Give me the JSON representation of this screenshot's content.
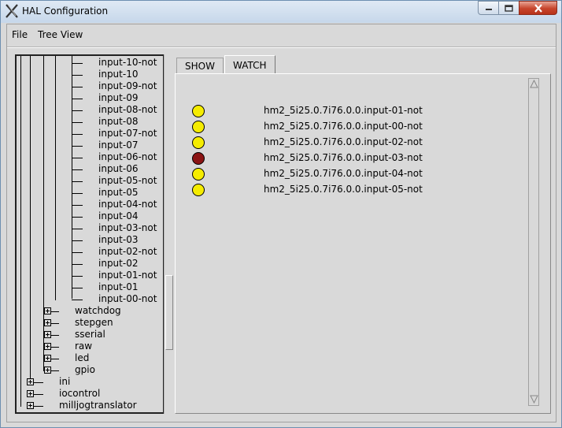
{
  "window": {
    "title": "HAL Configuration"
  },
  "menu": [
    "File",
    "Tree View"
  ],
  "tree": {
    "pins": [
      "input-10-not",
      "input-10",
      "input-09-not",
      "input-09",
      "input-08-not",
      "input-08",
      "input-07-not",
      "input-07",
      "input-06-not",
      "input-06",
      "input-05-not",
      "input-05",
      "input-04-not",
      "input-04",
      "input-03-not",
      "input-03",
      "input-02-not",
      "input-02",
      "input-01-not",
      "input-01",
      "input-00-not"
    ],
    "groups": [
      "watchdog",
      "stepgen",
      "sserial",
      "raw",
      "led",
      "gpio"
    ],
    "top_level": [
      "ini",
      "iocontrol",
      "milljogtranslator"
    ]
  },
  "tabs": [
    {
      "label": "SHOW",
      "active": false
    },
    {
      "label": "WATCH",
      "active": true
    }
  ],
  "watch": [
    {
      "name": "hm2_5i25.0.7i76.0.0.input-01-not",
      "state": "on",
      "color": "#f5ec00"
    },
    {
      "name": "hm2_5i25.0.7i76.0.0.input-00-not",
      "state": "on",
      "color": "#f5ec00"
    },
    {
      "name": "hm2_5i25.0.7i76.0.0.input-02-not",
      "state": "on",
      "color": "#f5ec00"
    },
    {
      "name": "hm2_5i25.0.7i76.0.0.input-03-not",
      "state": "off",
      "color": "#8b1414"
    },
    {
      "name": "hm2_5i25.0.7i76.0.0.input-04-not",
      "state": "on",
      "color": "#f5ec00"
    },
    {
      "name": "hm2_5i25.0.7i76.0.0.input-05-not",
      "state": "on",
      "color": "#f5ec00"
    }
  ]
}
